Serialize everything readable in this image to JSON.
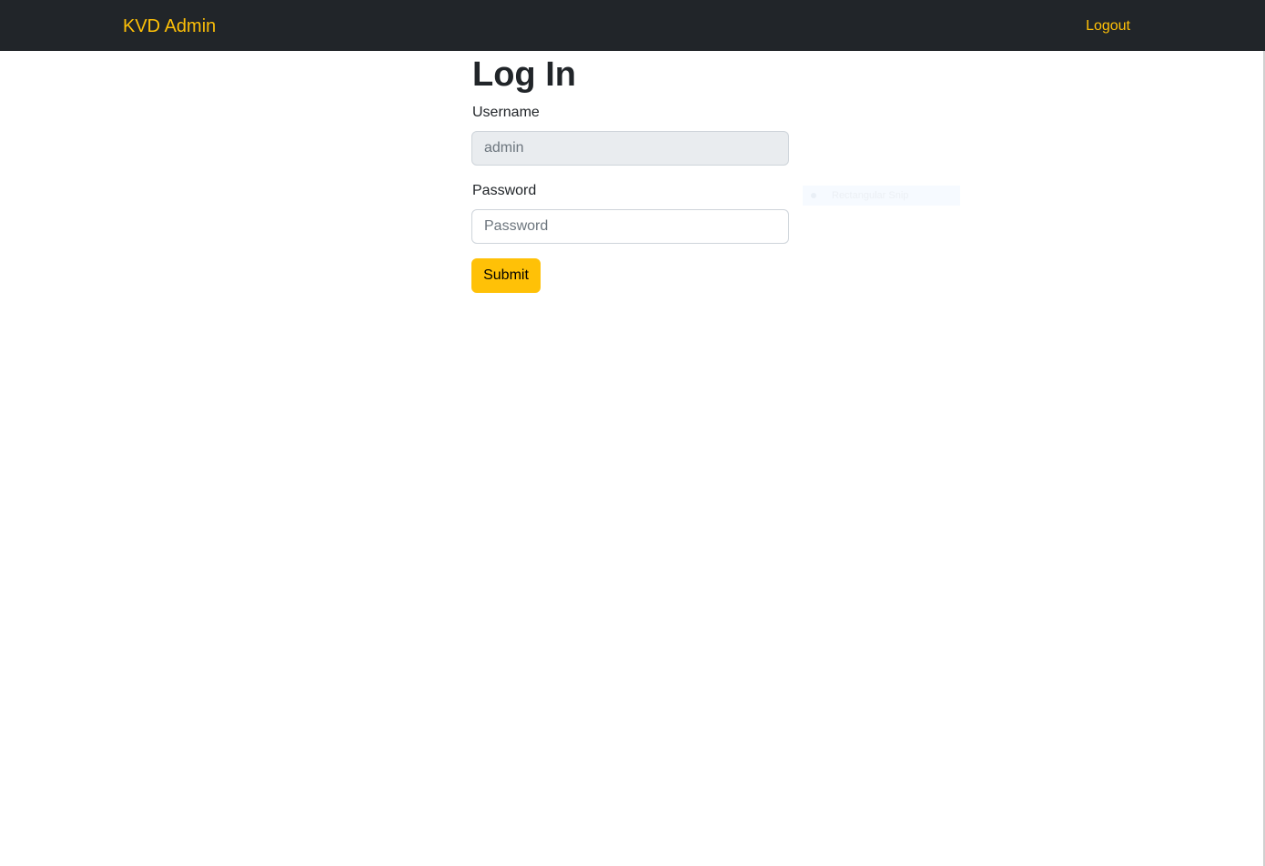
{
  "navbar": {
    "brand": "KVD Admin",
    "logout_label": "Logout",
    "accent_color": "#ffc107",
    "background_color": "#212529"
  },
  "login_form": {
    "title": "Log In",
    "username_label": "Username",
    "username_value": "admin",
    "password_label": "Password",
    "password_placeholder": "Password",
    "submit_label": "Submit",
    "submit_color": "#ffc107"
  },
  "snip_overlay": {
    "icon": "rectangle-snip-icon",
    "label": "Rectangular Snip"
  }
}
